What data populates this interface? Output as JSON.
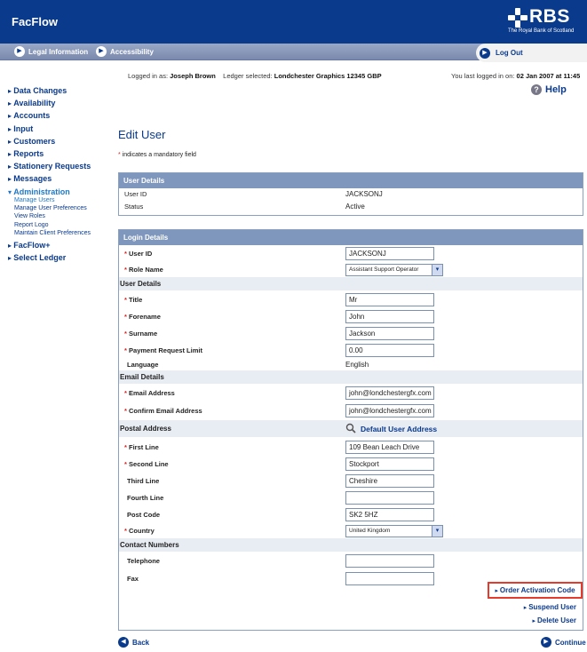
{
  "header": {
    "app_title": "FacFlow",
    "logo_text": "RBS",
    "logo_sub": "The Royal Bank of Scotland",
    "bg": "#0a3a8c"
  },
  "nav": {
    "legal": "Legal Information",
    "accessibility": "Accessibility",
    "logout": "Log Out"
  },
  "info": {
    "logged_as_label": "Logged in as:",
    "user": "Joseph Brown",
    "ledger_label": "Ledger selected:",
    "ledger": "Londchester Graphics 12345 GBP",
    "last_label": "You last logged in on:",
    "last": "02 Jan 2007 at 11:45",
    "help": "Help"
  },
  "sidebar": {
    "items": [
      "Data Changes",
      "Availability",
      "Accounts",
      "Input",
      "Customers",
      "Reports",
      "Stationery Requests",
      "Messages",
      "Administration",
      "FacFlow+",
      "Select Ledger"
    ],
    "admin_sub": [
      "Manage Users",
      "Manage User Preferences",
      "View Roles",
      "Report Logo",
      "Maintain Client Preferences"
    ]
  },
  "page": {
    "title": "Edit User",
    "mandatory": "indicates a mandatory field"
  },
  "user_details": {
    "header": "User Details",
    "user_id_label": "User ID",
    "user_id": "JACKSONJ",
    "status_label": "Status",
    "status": "Active"
  },
  "login": {
    "header": "Login Details",
    "user_id_label": "User ID",
    "user_id": "JACKSONJ",
    "role_label": "Role Name",
    "role": "Assistant Support Operator",
    "section_user": "User Details",
    "title_label": "Title",
    "title": "Mr",
    "forename_label": "Forename",
    "forename": "John",
    "surname_label": "Surname",
    "surname": "Jackson",
    "prl_label": "Payment Request Limit",
    "prl": "0.00",
    "language_label": "Language",
    "language": "English",
    "section_email": "Email Details",
    "email_label": "Email Address",
    "email": "john@londchestergfx.com",
    "confirm_label": "Confirm Email Address",
    "confirm": "john@londchestergfx.com",
    "section_postal": "Postal Address",
    "default_addr": "Default User Address",
    "l1_label": "First Line",
    "l1": "109 Bean Leach Drive",
    "l2_label": "Second Line",
    "l2": "Stockport",
    "l3_label": "Third Line",
    "l3": "Cheshire",
    "l4_label": "Fourth Line",
    "l4": "",
    "pc_label": "Post Code",
    "pc": "SK2 5HZ",
    "country_label": "Country",
    "country": "United Kingdom",
    "section_contact": "Contact Numbers",
    "tel_label": "Telephone",
    "tel": "",
    "fax_label": "Fax",
    "fax": ""
  },
  "actions": {
    "order": "Order Activation Code",
    "suspend": "Suspend User",
    "delete": "Delete User"
  },
  "footer": {
    "back": "Back",
    "continue": "Continue"
  }
}
